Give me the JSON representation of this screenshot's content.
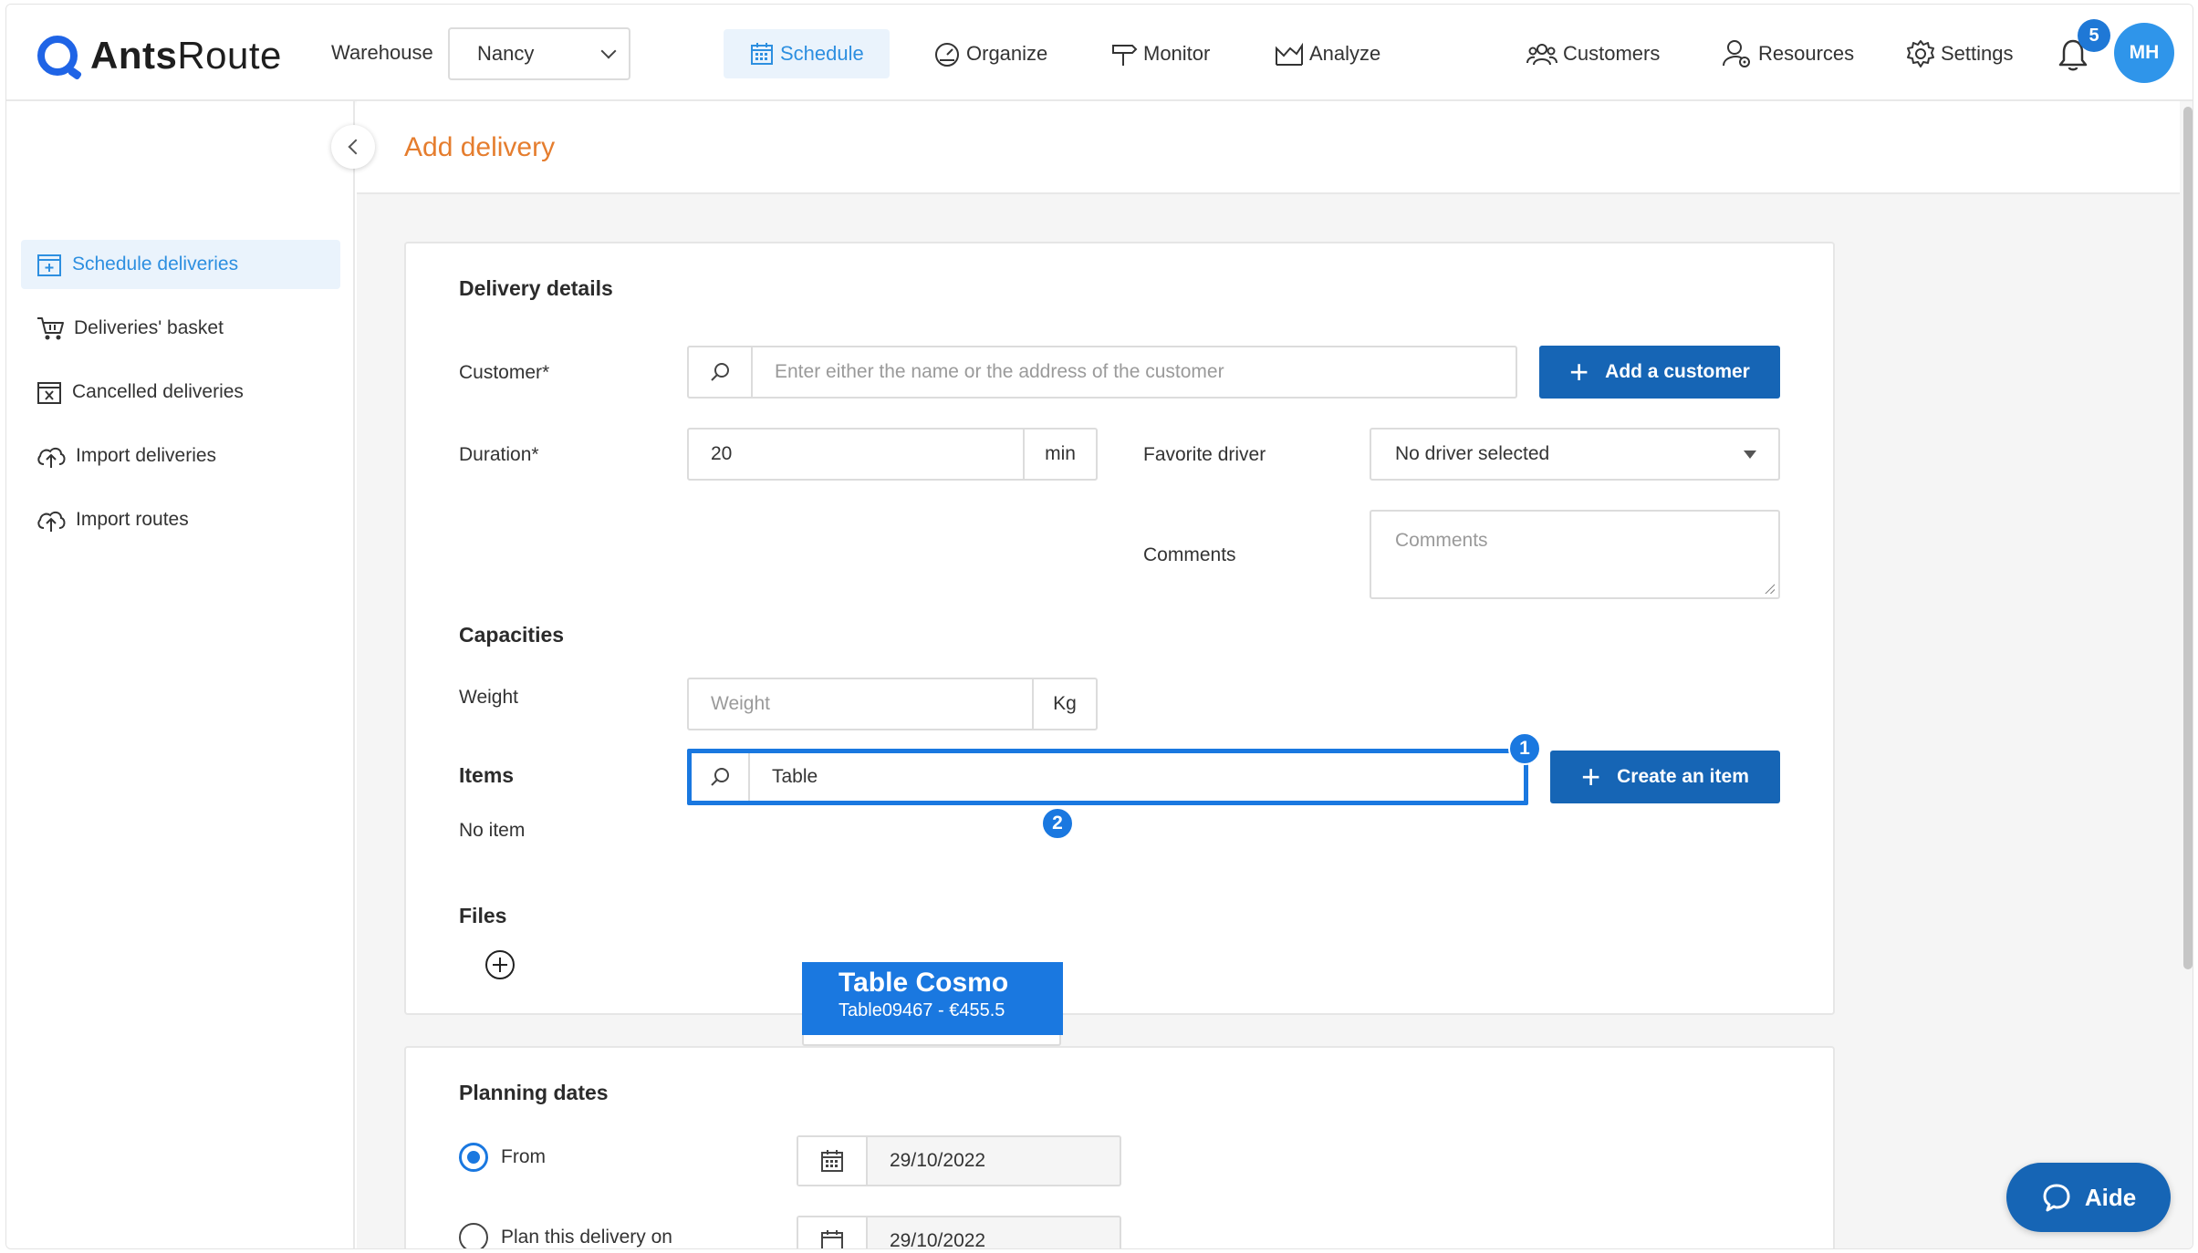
{
  "brand": {
    "name_bold": "Ants",
    "name_rest": "Route",
    "accent": "#1f64e6"
  },
  "topbar": {
    "warehouse_label": "Warehouse",
    "warehouse_value": "Nancy",
    "nav": [
      {
        "label": "Schedule",
        "icon": "calendar-icon",
        "active": true
      },
      {
        "label": "Organize",
        "icon": "gauge-icon"
      },
      {
        "label": "Monitor",
        "icon": "signpost-icon"
      },
      {
        "label": "Analyze",
        "icon": "chart-icon"
      },
      {
        "label": "Customers",
        "icon": "people-icon"
      },
      {
        "label": "Resources",
        "icon": "user-gear-icon"
      },
      {
        "label": "Settings",
        "icon": "gear-icon"
      }
    ],
    "notifications_count": "5",
    "avatar_initials": "MH"
  },
  "sidebar": {
    "items": [
      {
        "label": "Schedule deliveries",
        "icon": "calendar-plus-icon",
        "active": true
      },
      {
        "label": "Deliveries' basket",
        "icon": "basket-icon"
      },
      {
        "label": "Cancelled deliveries",
        "icon": "calendar-x-icon"
      },
      {
        "label": "Import deliveries",
        "icon": "cloud-upload-icon"
      },
      {
        "label": "Import routes",
        "icon": "cloud-upload-icon"
      }
    ]
  },
  "page": {
    "title": "Add delivery"
  },
  "delivery_details": {
    "title": "Delivery details",
    "customer_label": "Customer*",
    "customer_placeholder": "Enter either the name or the address of the customer",
    "add_customer_label": "Add a customer",
    "duration_label": "Duration*",
    "duration_value": "20",
    "duration_unit": "min",
    "favorite_driver_label": "Favorite driver",
    "favorite_driver_value": "No driver selected",
    "comments_label": "Comments",
    "comments_placeholder": "Comments",
    "capacities_title": "Capacities",
    "weight_label": "Weight",
    "weight_placeholder": "Weight",
    "weight_unit": "Kg",
    "items_title": "Items",
    "items_search_value": "Table",
    "no_item_text": "No item",
    "create_item_label": "Create an item",
    "step1_badge": "1",
    "step2_badge": "2",
    "suggestion": {
      "name": "Table Cosmo",
      "detail": "Table09467 - €455.5"
    },
    "files_title": "Files"
  },
  "planning_dates": {
    "title": "Planning dates",
    "from_label": "From",
    "from_value": "29/10/2022",
    "plan_on_label": "Plan this delivery on",
    "plan_on_value": "29/10/2022"
  },
  "help": {
    "label": "Aide"
  }
}
